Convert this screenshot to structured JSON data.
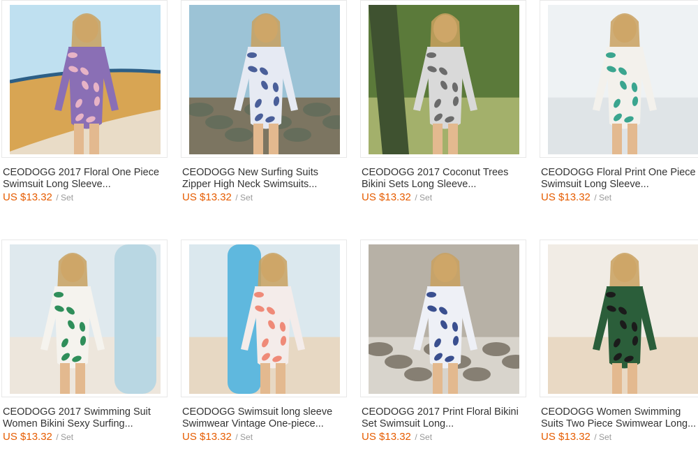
{
  "products": [
    {
      "title_line1": "CEODOGG 2017 Floral One Piece",
      "title_line2": "Swimsuit Long Sleeve...",
      "price": "US $13.32",
      "unit": "/ Set",
      "image": "beach-surfboard-purple-floral",
      "colors": {
        "bg": "#bfe0f0",
        "ground": "#e9dcc7",
        "suit": "#8a6fb5",
        "accent": "#e7b3c6",
        "prop": "#d8a553"
      }
    },
    {
      "title_line1": "CEODOGG New Surfing Suits",
      "title_line2": "Zipper High Neck Swimsuits...",
      "price": "US $13.32",
      "unit": "/ Set",
      "image": "rocky-shore-blue-floral",
      "colors": {
        "bg": "#9cc3d6",
        "ground": "#7c7561",
        "suit": "#e6eaf3",
        "accent": "#4a5f99",
        "prop": "#5e6b5a"
      }
    },
    {
      "title_line1": "CEODOGG 2017 Coconut Trees",
      "title_line2": "Bikini Sets Long Sleeve...",
      "price": "US $13.32",
      "unit": "/ Set",
      "image": "palm-trees-grey-bikini",
      "colors": {
        "bg": "#5b7a3a",
        "ground": "#a3b06b",
        "suit": "#d9d9d9",
        "accent": "#6b6b6b",
        "prop": "#3f5230"
      }
    },
    {
      "title_line1": "CEODOGG Floral Print One Piece",
      "title_line2": "Swimsuit Long Sleeve...",
      "price": "US $13.32",
      "unit": "/ Set",
      "image": "white-wall-teal-floral",
      "colors": {
        "bg": "#eef2f4",
        "ground": "#dfe4e7",
        "suit": "#f3f1ec",
        "accent": "#3aa58f",
        "prop": "#e98aa2"
      }
    },
    {
      "title_line1": "CEODOGG 2017 Swimming Suit",
      "title_line2": "Women Bikini Sexy Surfing...",
      "price": "US $13.32",
      "unit": "/ Set",
      "image": "sea-white-board-green-leaf",
      "colors": {
        "bg": "#dfe9ee",
        "ground": "#ede6dc",
        "suit": "#f5f3ee",
        "accent": "#2f8e5a",
        "prop": "#b9d7e3"
      }
    },
    {
      "title_line1": "CEODOGG Swimsuit long sleeve",
      "title_line2": "Swimwear Vintage One-piece...",
      "price": "US $13.32",
      "unit": "/ Set",
      "image": "blue-board-pink-leaf",
      "colors": {
        "bg": "#dbe8ee",
        "ground": "#e7d8c3",
        "suit": "#f4ecea",
        "accent": "#ef8a78",
        "prop": "#5fb8de"
      }
    },
    {
      "title_line1": "CEODOGG 2017 Print Floral Bikini",
      "title_line2": "Set Swimsuit Long...",
      "price": "US $13.32",
      "unit": "/ Set",
      "image": "rocks-blue-floral-bikini",
      "colors": {
        "bg": "#b7b1a6",
        "ground": "#d8d4cc",
        "suit": "#eef0f6",
        "accent": "#3a4f8f",
        "prop": "#6b6355"
      }
    },
    {
      "title_line1": "CEODOGG Women Swimming",
      "title_line2": "Suits Two Piece Swimwear Long...",
      "price": "US $13.32",
      "unit": "/ Set",
      "image": "misty-beach-green-top-black-shorts",
      "colors": {
        "bg": "#f1ece5",
        "ground": "#e9d9c4",
        "suit": "#2b5e3a",
        "accent": "#1b1b1b",
        "prop": "#d9cbb8"
      }
    }
  ]
}
